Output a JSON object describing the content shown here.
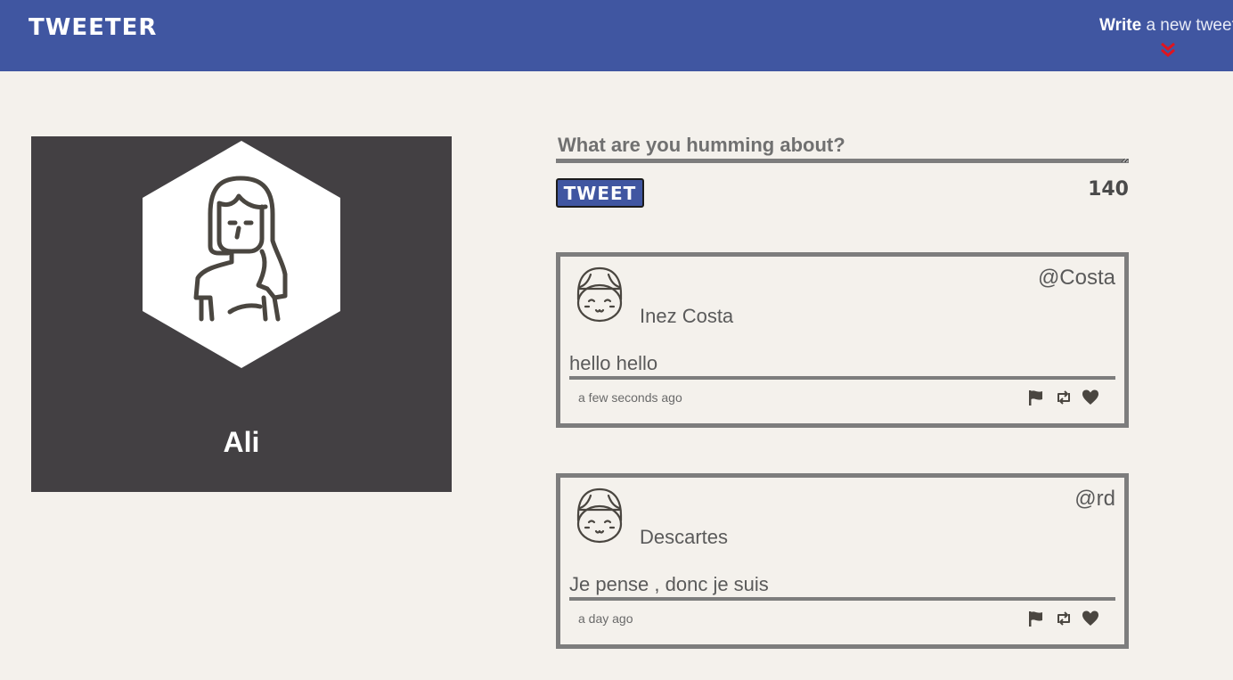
{
  "nav": {
    "logo": "TWEETER",
    "compose_toggle_bold": "Write",
    "compose_toggle_rest": " a new tweet",
    "chevron_icon": "double-chevron-down-icon",
    "colors": {
      "bar": "#4056a1",
      "chevron": "#e0141e"
    }
  },
  "profile": {
    "avatar_icon": "woman-avatar-icon",
    "name": "Ali"
  },
  "compose": {
    "label": "What are you humming about?",
    "button": "TWEET",
    "counter": "140"
  },
  "tweets": [
    {
      "avatar_icon": "girl-avatar-icon",
      "handle": "@Costa",
      "name": "Inez Costa",
      "text": "hello hello",
      "time": "a few seconds ago",
      "actions": [
        "flag-icon",
        "retweet-icon",
        "heart-icon"
      ]
    },
    {
      "avatar_icon": "girl-avatar-icon",
      "handle": "@rd",
      "name": "Descartes",
      "text": "Je pense , donc je suis",
      "time": "a day ago",
      "actions": [
        "flag-icon",
        "retweet-icon",
        "heart-icon"
      ]
    }
  ]
}
